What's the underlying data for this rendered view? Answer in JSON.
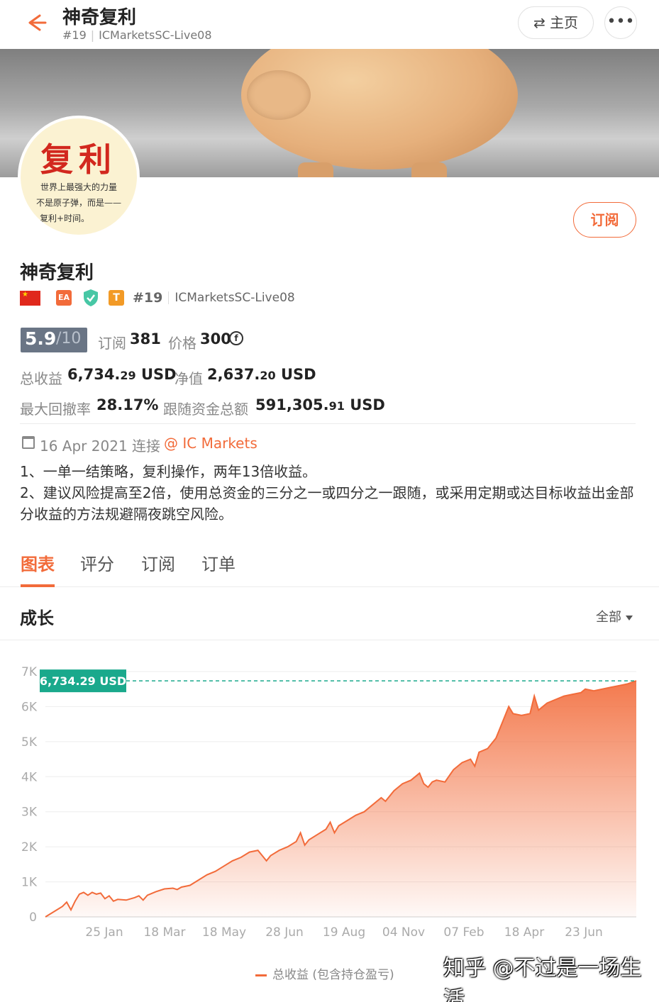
{
  "header": {
    "title": "神奇复利",
    "rank": "#19",
    "server": "ICMarketsSC-Live08",
    "home_label": "主页",
    "switch_icon": "⇄",
    "more_icon": "•••"
  },
  "avatar": {
    "big_text": "复利",
    "line1": "世界上最强大的力量",
    "line2": "不是原子弹，而是——",
    "line3": "复利+时间。"
  },
  "subscribe_label": "订阅",
  "profile": {
    "name": "神奇复利",
    "ea_badge": "EA",
    "t_badge": "T",
    "rank": "#19",
    "server": "ICMarketsSC-Live08"
  },
  "stats": {
    "score": "5.9",
    "score_max": "/10",
    "subscribe_label": "订阅",
    "subscribe_count": "381",
    "price_label": "价格",
    "price_value": "300",
    "total_profit_label": "总收益",
    "total_profit_int": "6,734.",
    "total_profit_dec": "29",
    "usd": "USD",
    "equity_label": "净值",
    "equity_int": "2,637.",
    "equity_dec": "20",
    "max_dd_label": "最大回撤率",
    "max_dd_value": "28.17%",
    "follow_funds_label": "跟随资金总额",
    "follow_funds_int": "591,305.",
    "follow_funds_dec": "91"
  },
  "connection": {
    "date_text": "16 Apr 2021 连接",
    "broker": "@ IC Markets"
  },
  "description": {
    "line1": "1、一单一结策略，复利操作，两年13倍收益。",
    "line2": "2、建议风险提高至2倍，使用总资金的三分之一或四分之一跟随，或采用定期或达目标收益出金部分收益的方法规避隔夜跳空风险。"
  },
  "tabs": [
    "图表",
    "评分",
    "订阅",
    "订单"
  ],
  "growth": {
    "title": "成长",
    "range_label": "全部"
  },
  "chart_data": {
    "type": "area",
    "title": "成长",
    "series": [
      {
        "name": "总收益 (包含持仓盈亏)",
        "color": "#f26b3a"
      }
    ],
    "x_tick_labels": [
      "25 Jan",
      "18 Mar",
      "18 May",
      "28 Jun",
      "19 Aug",
      "04 Nov",
      "07 Feb",
      "18 Apr",
      "23 Jun"
    ],
    "y_tick_labels": [
      "0",
      "1K",
      "2K",
      "3K",
      "4K",
      "5K",
      "6K",
      "7K"
    ],
    "ylim": [
      0,
      7000
    ],
    "grid": true,
    "current_value_label": "6,734.29 USD",
    "current_value": 6734.29,
    "points": [
      [
        0,
        0
      ],
      [
        2,
        150
      ],
      [
        4,
        300
      ],
      [
        5,
        420
      ],
      [
        6,
        200
      ],
      [
        7,
        450
      ],
      [
        8,
        650
      ],
      [
        9,
        700
      ],
      [
        10,
        620
      ],
      [
        11,
        700
      ],
      [
        12,
        650
      ],
      [
        13,
        680
      ],
      [
        14,
        520
      ],
      [
        15,
        600
      ],
      [
        16,
        450
      ],
      [
        17,
        500
      ],
      [
        19,
        480
      ],
      [
        21,
        550
      ],
      [
        22,
        600
      ],
      [
        23,
        480
      ],
      [
        24,
        620
      ],
      [
        26,
        720
      ],
      [
        28,
        800
      ],
      [
        30,
        820
      ],
      [
        31,
        780
      ],
      [
        32,
        850
      ],
      [
        34,
        900
      ],
      [
        36,
        1050
      ],
      [
        38,
        1200
      ],
      [
        40,
        1300
      ],
      [
        42,
        1450
      ],
      [
        44,
        1600
      ],
      [
        46,
        1700
      ],
      [
        48,
        1850
      ],
      [
        50,
        1900
      ],
      [
        51,
        1750
      ],
      [
        52,
        1600
      ],
      [
        53,
        1750
      ],
      [
        55,
        1900
      ],
      [
        57,
        2000
      ],
      [
        59,
        2150
      ],
      [
        60,
        2400
      ],
      [
        61,
        2050
      ],
      [
        62,
        2200
      ],
      [
        64,
        2350
      ],
      [
        66,
        2500
      ],
      [
        67,
        2700
      ],
      [
        68,
        2400
      ],
      [
        69,
        2600
      ],
      [
        71,
        2750
      ],
      [
        73,
        2900
      ],
      [
        75,
        3000
      ],
      [
        77,
        3200
      ],
      [
        79,
        3400
      ],
      [
        80,
        3300
      ],
      [
        82,
        3600
      ],
      [
        84,
        3800
      ],
      [
        86,
        3900
      ],
      [
        88,
        4100
      ],
      [
        89,
        3800
      ],
      [
        90,
        3700
      ],
      [
        91,
        3850
      ],
      [
        92,
        3900
      ],
      [
        94,
        3850
      ],
      [
        96,
        4200
      ],
      [
        98,
        4400
      ],
      [
        100,
        4500
      ],
      [
        101,
        4300
      ],
      [
        102,
        4700
      ],
      [
        104,
        4800
      ],
      [
        106,
        5100
      ],
      [
        108,
        5700
      ],
      [
        109,
        6000
      ],
      [
        110,
        5800
      ],
      [
        112,
        5750
      ],
      [
        114,
        5800
      ],
      [
        115,
        6300
      ],
      [
        116,
        5900
      ],
      [
        118,
        6100
      ],
      [
        120,
        6200
      ],
      [
        122,
        6300
      ],
      [
        124,
        6350
      ],
      [
        126,
        6400
      ],
      [
        127,
        6500
      ],
      [
        129,
        6450
      ],
      [
        131,
        6500
      ],
      [
        133,
        6550
      ],
      [
        135,
        6600
      ],
      [
        137,
        6650
      ],
      [
        139,
        6734.29
      ]
    ]
  },
  "legend_label": "总收益 (包含持仓盈亏)",
  "watermark": "知乎 @不过是一场生活"
}
